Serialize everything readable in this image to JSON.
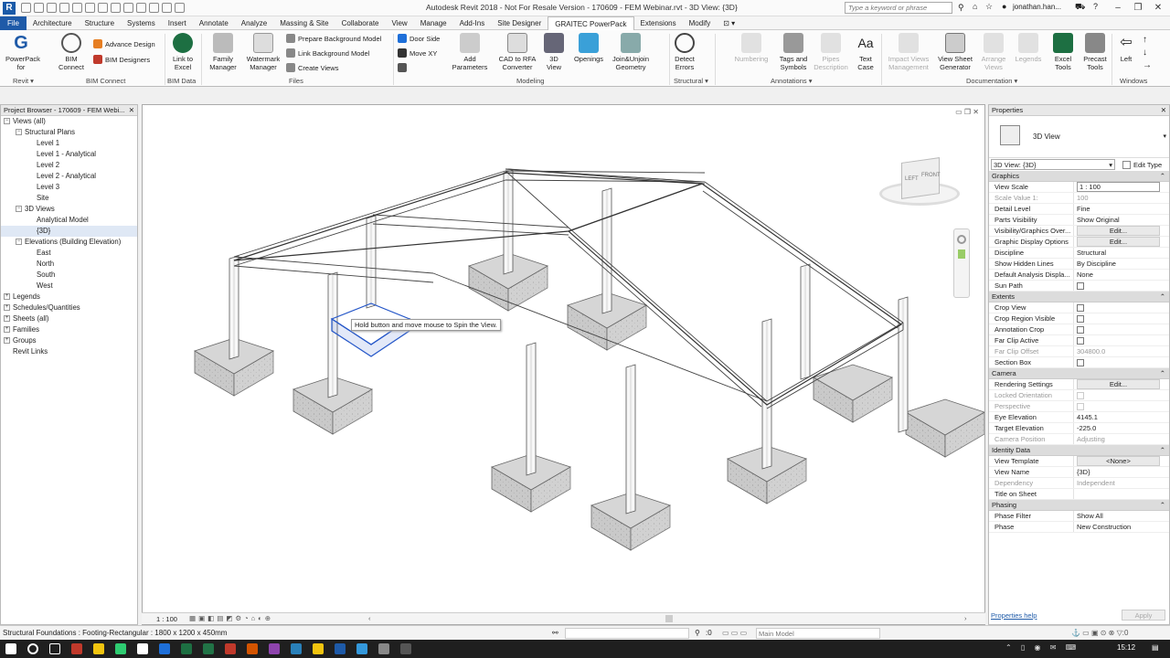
{
  "window": {
    "title": "Autodesk Revit 2018 - Not For Resale Version -   170609 - FEM Webinar.rvt - 3D View: {3D}",
    "search_placeholder": "Type a keyword or phrase",
    "user": "jonathan.han...",
    "app_letter": "R"
  },
  "tabs": [
    "Architecture",
    "Structure",
    "Systems",
    "Insert",
    "Annotate",
    "Analyze",
    "Massing & Site",
    "Collaborate",
    "View",
    "Manage",
    "Add-Ins",
    "Site Designer",
    "GRAITEC PowerPack",
    "Extensions",
    "Modify"
  ],
  "file_tab": "File",
  "active_tab": "GRAITEC PowerPack",
  "ribbon": {
    "powerpack": "PowerPack\nfor",
    "bim_connect": "BIM\nConnect",
    "advance_design": "Advance Design",
    "bim_designers": "BIM Designers",
    "link_to_excel": "Link to\nExcel",
    "family_manager": "Family\nManager",
    "watermark_manager": "Watermark\nManager",
    "prepare_bg": "Prepare Background Model",
    "link_bg": "Link Background Model",
    "create_views": "Create Views",
    "door_side": "Door Side",
    "move_xy": "Move XY",
    "add_parameters": "Add\nParameters",
    "cad_to_rfa": "CAD to RFA\nConverter",
    "view_3d": "3D\nView",
    "openings": "Openings",
    "join_unjoin": "Join&Unjoin\nGeometry",
    "detect_errors": "Detect\nErrors",
    "numbering": "Numbering",
    "tags_symbols": "Tags and\nSymbols",
    "pipes_description": "Pipes\nDescription",
    "text_case": "Text\nCase",
    "impact_views": "Impact Views\nManagement",
    "view_sheet_gen": "View Sheet\nGenerator",
    "arrange_views": "Arrange\nViews",
    "legends": "Legends",
    "excel_tools": "Excel\nTools",
    "precast_tools": "Precast\nTools",
    "left": "Left",
    "panels": [
      "Revit ▾",
      "BIM Connect",
      "BIM Data",
      "Files",
      "Modeling",
      "Structural ▾",
      "Annotations ▾",
      "Documentation ▾",
      "Windows"
    ]
  },
  "project_browser": {
    "title": "Project Browser - 170609 - FEM Webi...",
    "items": [
      {
        "label": "Views (all)",
        "level": 0,
        "exp": "−"
      },
      {
        "label": "Structural Plans",
        "level": 1,
        "exp": "−"
      },
      {
        "label": "Level 1",
        "level": 2
      },
      {
        "label": "Level 1 - Analytical",
        "level": 2
      },
      {
        "label": "Level 2",
        "level": 2
      },
      {
        "label": "Level 2 - Analytical",
        "level": 2
      },
      {
        "label": "Level 3",
        "level": 2
      },
      {
        "label": "Site",
        "level": 2
      },
      {
        "label": "3D Views",
        "level": 1,
        "exp": "−"
      },
      {
        "label": "Analytical Model",
        "level": 2
      },
      {
        "label": "{3D}",
        "level": 2,
        "selected": true
      },
      {
        "label": "Elevations (Building Elevation)",
        "level": 1,
        "exp": "−"
      },
      {
        "label": "East",
        "level": 2
      },
      {
        "label": "North",
        "level": 2
      },
      {
        "label": "South",
        "level": 2
      },
      {
        "label": "West",
        "level": 2
      },
      {
        "label": "Legends",
        "level": 0,
        "exp": "+"
      },
      {
        "label": "Schedules/Quantities",
        "level": 0,
        "exp": "+"
      },
      {
        "label": "Sheets (all)",
        "level": 0,
        "exp": "+"
      },
      {
        "label": "Families",
        "level": 0,
        "exp": "+"
      },
      {
        "label": "Groups",
        "level": 0,
        "exp": "+"
      },
      {
        "label": "Revit Links",
        "level": 0
      }
    ]
  },
  "viewport": {
    "tooltip": "Hold button and move mouse to Spin the View.",
    "scale": "1 : 100",
    "viewcube_left": "LEFT",
    "viewcube_front": "FRONT"
  },
  "properties": {
    "title": "Properties",
    "type_name": "3D View",
    "selector": "3D View: {3D}",
    "edit_type": "Edit Type",
    "help": "Properties help",
    "apply": "Apply",
    "groups": [
      {
        "name": "Graphics",
        "rows": [
          {
            "k": "View Scale",
            "v": "1 : 100",
            "input": true
          },
          {
            "k": "Scale Value    1:",
            "v": "100",
            "dim": true
          },
          {
            "k": "Detail Level",
            "v": "Fine"
          },
          {
            "k": "Parts Visibility",
            "v": "Show Original"
          },
          {
            "k": "Visibility/Graphics Over...",
            "v": "Edit...",
            "button": true
          },
          {
            "k": "Graphic Display Options",
            "v": "Edit...",
            "button": true
          },
          {
            "k": "Discipline",
            "v": "Structural"
          },
          {
            "k": "Show Hidden Lines",
            "v": "By Discipline"
          },
          {
            "k": "Default Analysis Displa...",
            "v": "None"
          },
          {
            "k": "Sun Path",
            "v": "",
            "check": true
          }
        ]
      },
      {
        "name": "Extents",
        "rows": [
          {
            "k": "Crop View",
            "v": "",
            "check": true
          },
          {
            "k": "Crop Region Visible",
            "v": "",
            "check": true
          },
          {
            "k": "Annotation Crop",
            "v": "",
            "check": true
          },
          {
            "k": "Far Clip Active",
            "v": "",
            "check": true
          },
          {
            "k": "Far Clip Offset",
            "v": "304800.0",
            "dim": true
          },
          {
            "k": "Section Box",
            "v": "",
            "check": true
          }
        ]
      },
      {
        "name": "Camera",
        "rows": [
          {
            "k": "Rendering Settings",
            "v": "Edit...",
            "button": true
          },
          {
            "k": "Locked Orientation",
            "v": "",
            "dim": true,
            "check": true
          },
          {
            "k": "Perspective",
            "v": "",
            "dim": true,
            "check": true
          },
          {
            "k": "Eye Elevation",
            "v": "4145.1"
          },
          {
            "k": "Target Elevation",
            "v": "-225.0"
          },
          {
            "k": "Camera Position",
            "v": "Adjusting",
            "dim": true
          }
        ]
      },
      {
        "name": "Identity Data",
        "rows": [
          {
            "k": "View Template",
            "v": "<None>",
            "button": true
          },
          {
            "k": "View Name",
            "v": "{3D}"
          },
          {
            "k": "Dependency",
            "v": "Independent",
            "dim": true
          },
          {
            "k": "Title on Sheet",
            "v": ""
          }
        ]
      },
      {
        "name": "Phasing",
        "rows": [
          {
            "k": "Phase Filter",
            "v": "Show All"
          },
          {
            "k": "Phase",
            "v": "New Construction"
          }
        ]
      }
    ]
  },
  "statusbar": {
    "text": "Structural Foundations : Footing-Rectangular : 1800 x 1200 x 450mm",
    "coord": ":0",
    "main_model": "Main Model"
  },
  "taskbar": {
    "time": "15:12",
    "colors": [
      "#ffffff",
      "#ffffff",
      "#ffffff",
      "#c0392b",
      "#f1c40f",
      "#2ecc71",
      "#ffffff",
      "#1e6fd9",
      "#1d6f42",
      "#217346",
      "#c0392b",
      "#d35400",
      "#8e44ad",
      "#2980b9",
      "#f1c40f",
      "#1e5aa8",
      "#3498db",
      "#888888",
      "#555555"
    ]
  }
}
